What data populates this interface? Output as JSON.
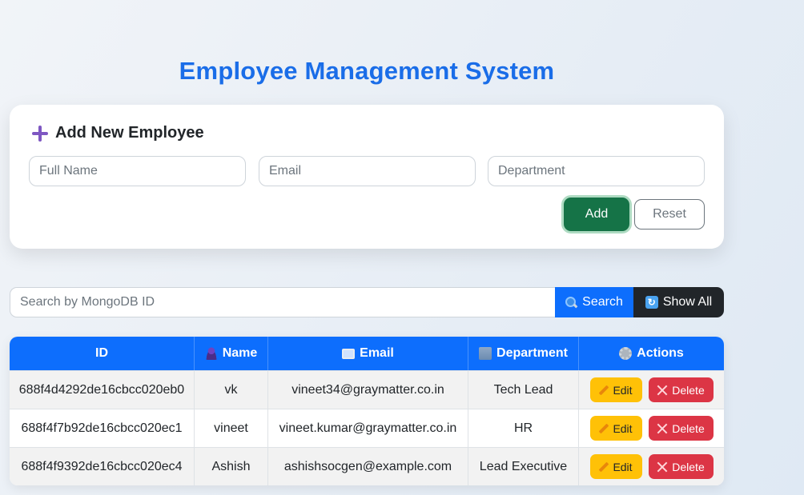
{
  "page": {
    "title": "Employee Management System"
  },
  "add_form": {
    "heading": "Add New Employee",
    "fields": {
      "name_placeholder": "Full Name",
      "email_placeholder": "Email",
      "department_placeholder": "Department"
    },
    "add_label": "Add",
    "reset_label": "Reset"
  },
  "search": {
    "placeholder": "Search by MongoDB ID",
    "search_label": "Search",
    "show_all_label": "Show All"
  },
  "table": {
    "headers": {
      "id": "ID",
      "name": "Name",
      "email": "Email",
      "department": "Department",
      "actions": "Actions"
    },
    "edit_label": "Edit",
    "delete_label": "Delete",
    "rows": [
      {
        "id": "688f4d4292de16cbcc020eb0",
        "name": "vk",
        "email": "vineet34@graymatter.co.in",
        "department": "Tech Lead"
      },
      {
        "id": "688f4f7b92de16cbcc020ec1",
        "name": "vineet",
        "email": "vineet.kumar@graymatter.co.in",
        "department": "HR"
      },
      {
        "id": "688f4f9392de16cbcc020ec4",
        "name": "Ashish",
        "email": "ashishsocgen@example.com",
        "department": "Lead Executive"
      }
    ]
  },
  "colors": {
    "title": "#1a6de8",
    "primary": "#0d6efd",
    "success": "#157347",
    "warning": "#ffc107",
    "danger": "#dc3545",
    "dark": "#212529"
  },
  "icons": {
    "add_heading": "plus-icon",
    "search": "magnifier-icon",
    "show_all": "refresh-icon",
    "name_header": "person-icon",
    "email_header": "email-icon",
    "department_header": "building-icon",
    "actions_header": "gear-icon",
    "edit": "pencil-icon",
    "delete": "x-icon"
  }
}
